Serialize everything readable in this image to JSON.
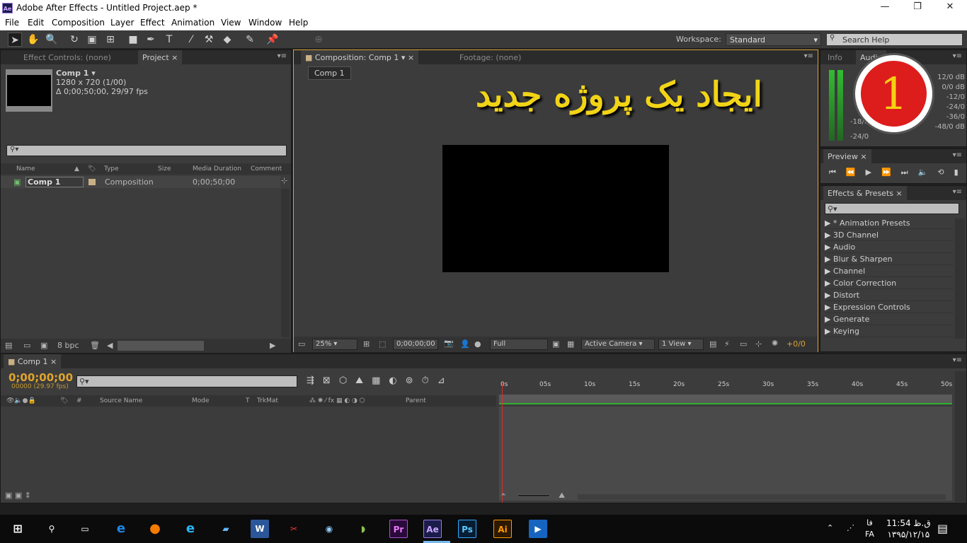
{
  "window": {
    "logo": "Ae",
    "title": "Adobe After Effects - Untitled Project.aep *",
    "minimize": "—",
    "maximize": "❐",
    "close": "✕"
  },
  "menu": [
    "File",
    "Edit",
    "Composition",
    "Layer",
    "Effect",
    "Animation",
    "View",
    "Window",
    "Help"
  ],
  "toolbar": {
    "workspace_label": "Workspace:",
    "workspace_value": "Standard",
    "search_placeholder": "Search Help"
  },
  "project_panel": {
    "tab_effect_controls": "Effect Controls: (none)",
    "tab_project": "Project",
    "comp_name": "Comp 1 ▾",
    "comp_size": "1280 x 720 (1/00)",
    "comp_duration": "Δ 0;00;50;00, 29/97 fps",
    "columns": [
      "Name",
      "Type",
      "Size",
      "Media Duration",
      "Comment"
    ],
    "row": {
      "name": "Comp 1",
      "type": "Composition",
      "duration": "0;00;50;00"
    },
    "bpc": "8 bpc"
  },
  "comp_panel": {
    "tab_comp": "Composition: Comp 1",
    "tab_footage": "Footage: (none)",
    "comp_button": "Comp 1",
    "zoom": "25%",
    "timecode": "0;00;00;00",
    "resolution": "Full",
    "camera": "Active Camera",
    "view": "1 View",
    "exposure": "+0/0"
  },
  "overlay": {
    "text": "ایجاد یک پروژه جدید",
    "badge_number": "1"
  },
  "info_panel": {
    "tab_info": "Info",
    "tab_audio": "Audio",
    "levels": [
      "12/0 dB",
      "0/0 dB",
      "-12/0",
      "-24/0",
      "-36/0",
      "-48/0 dB"
    ],
    "left_levels": [
      "-18/0",
      "-24/0"
    ]
  },
  "preview_panel": {
    "tab": "Preview"
  },
  "effects_panel": {
    "tab": "Effects & Presets",
    "items": [
      "* Animation Presets",
      "3D Channel",
      "Audio",
      "Blur & Sharpen",
      "Channel",
      "Color Correction",
      "Distort",
      "Expression Controls",
      "Generate",
      "Keying"
    ]
  },
  "timeline": {
    "tab": "Comp 1",
    "timecode": "0;00;00;00",
    "fps": "00000 (29.97 fps)",
    "columns": [
      "#",
      "Source Name",
      "Mode",
      "T",
      "TrkMat",
      "Parent"
    ],
    "ticks": [
      "0s",
      "05s",
      "10s",
      "15s",
      "20s",
      "25s",
      "30s",
      "35s",
      "40s",
      "45s",
      "50s"
    ]
  },
  "taskbar": {
    "apps": [
      "Pr",
      "Ae",
      "Ps",
      "Ai"
    ],
    "lang_top": "فا",
    "lang": "FA",
    "time": "11:54 ق.ظ",
    "date": "۱۳۹۵/۱۲/۱۵"
  },
  "colors": {
    "accent": "#d9a23a",
    "timecode": "#e0a42c",
    "overlay_text": "#f2d417",
    "badge": "#dd1c1c"
  }
}
